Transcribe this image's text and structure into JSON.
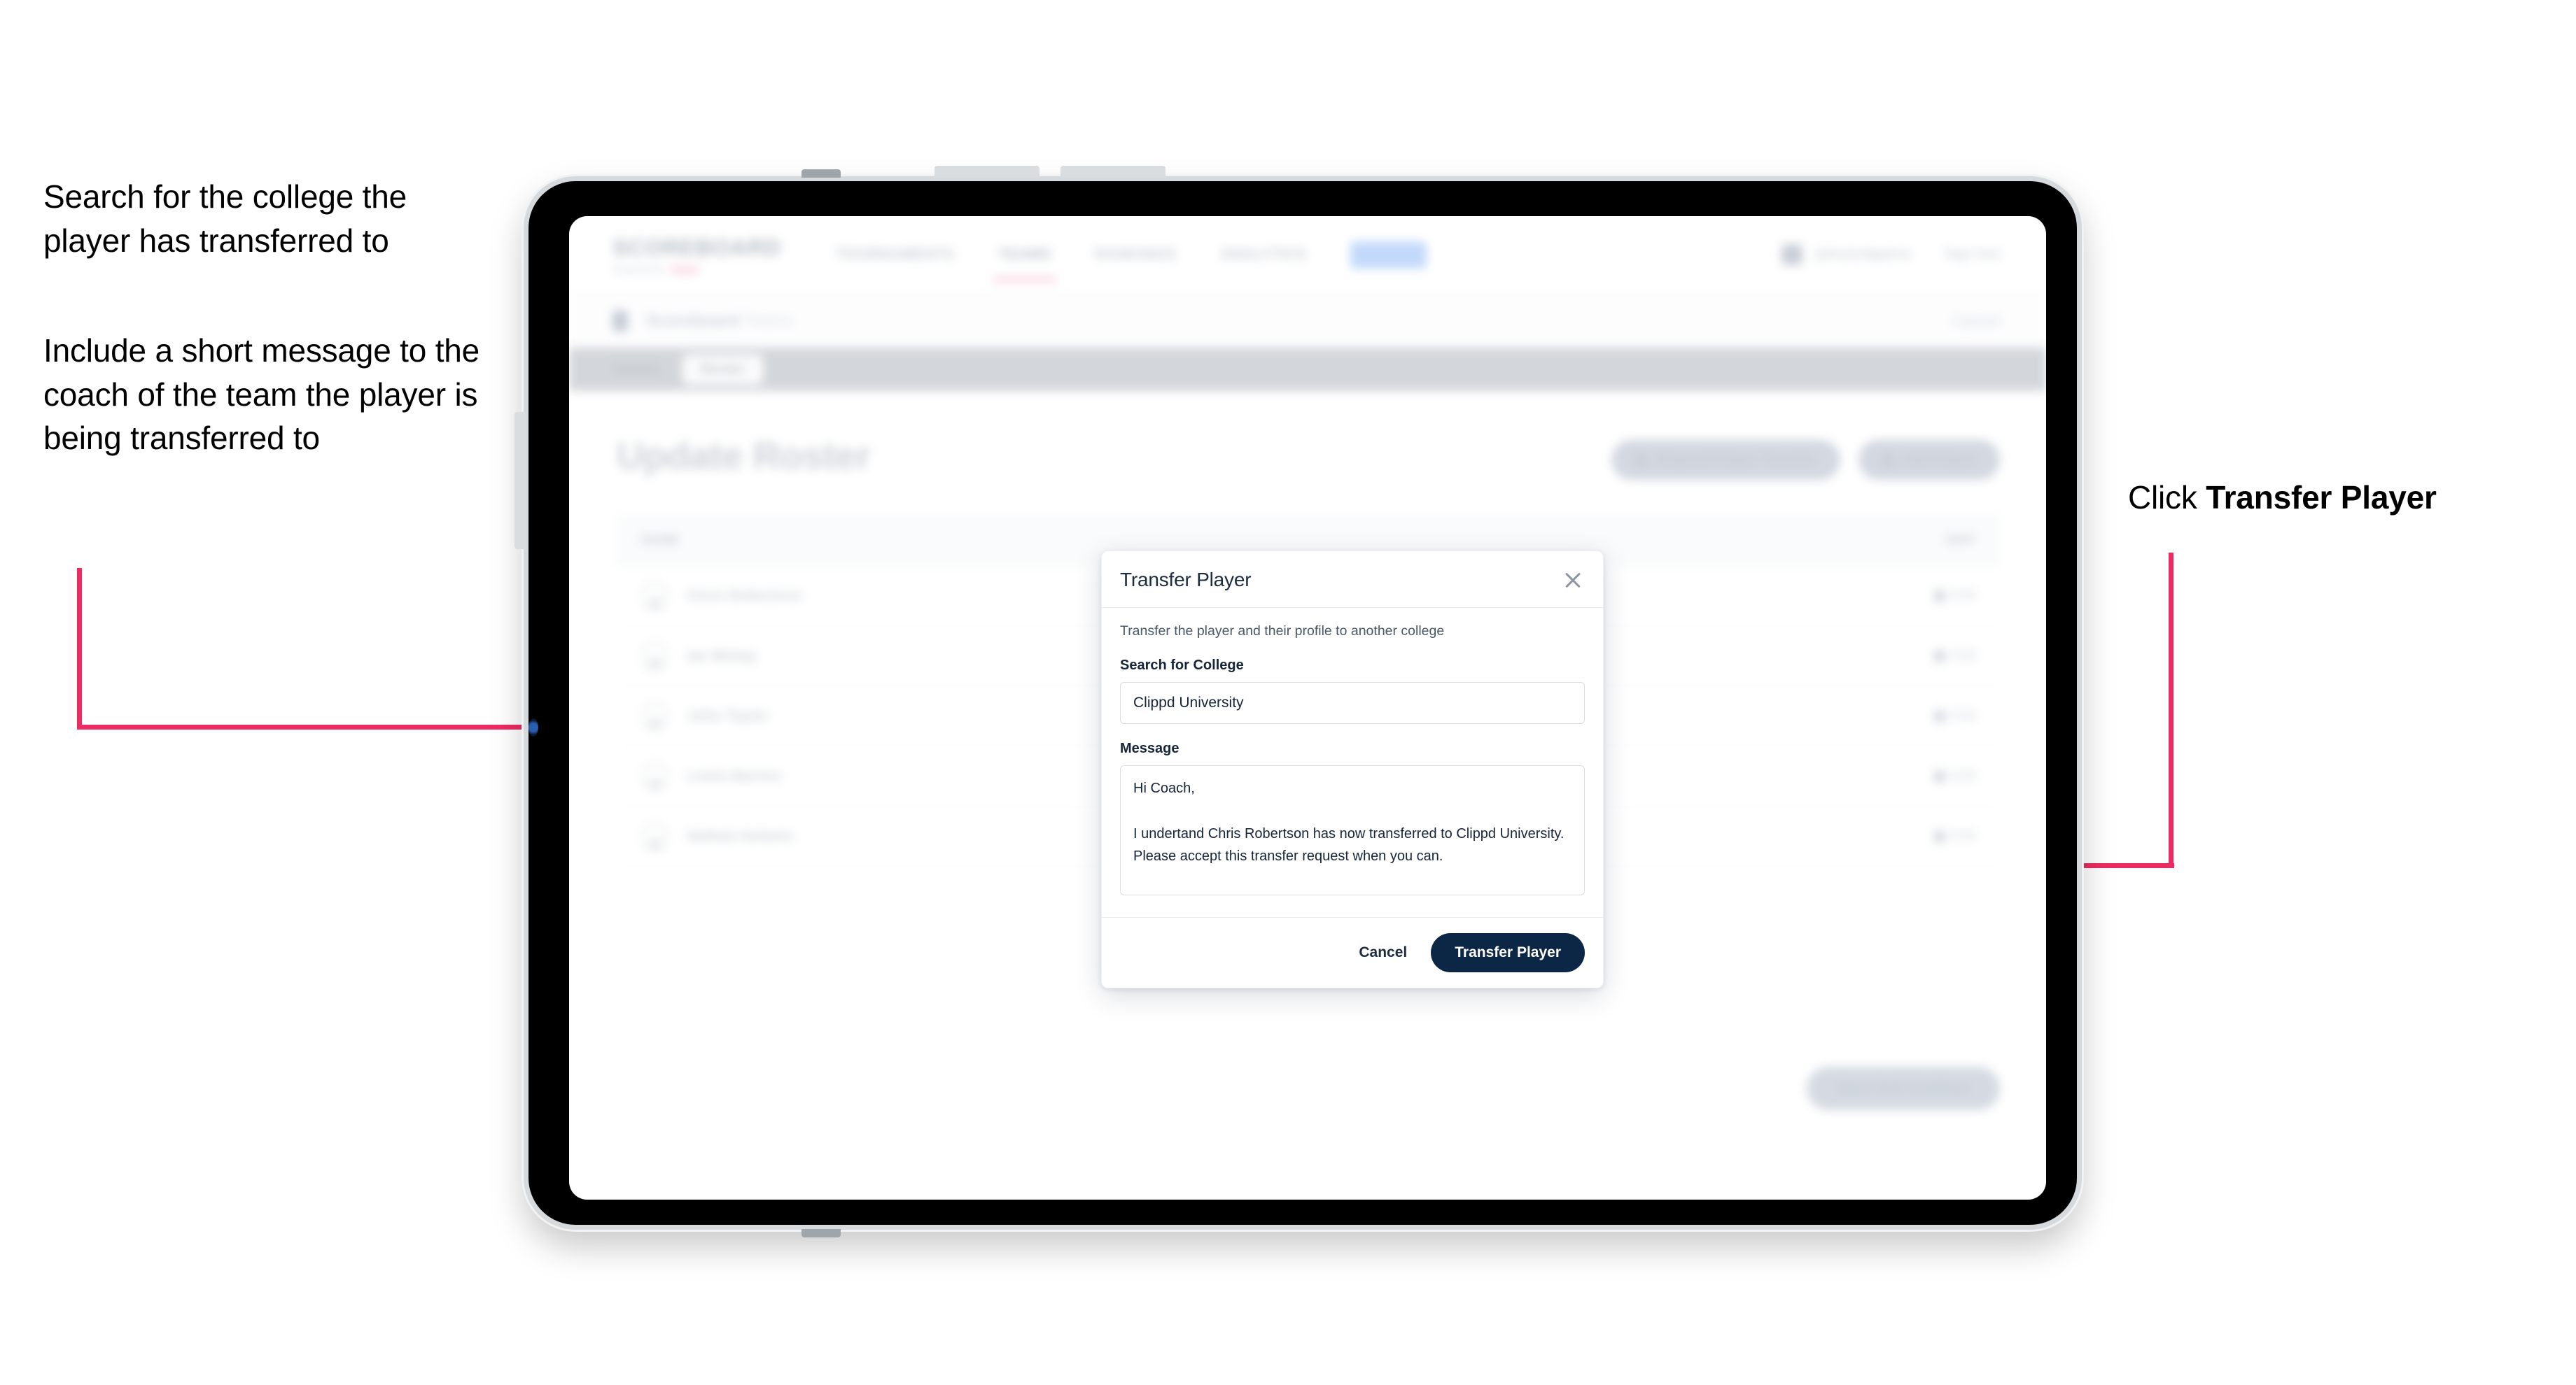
{
  "annotations": {
    "left_1": "Search for the college the player has transferred to",
    "left_2": "Include a short message to the coach of the team the player is being transferred to",
    "right_1_prefix": "Click ",
    "right_1_bold": "Transfer Player"
  },
  "colors": {
    "accent_pink": "#ed2b62",
    "primary_navy": "#0c2745",
    "modal_text": "#16243a"
  },
  "app": {
    "brand": {
      "name": "SCOREBOARD",
      "sub": "Powered by",
      "sub_accent": "clippd"
    },
    "nav": [
      {
        "label": "TOURNAMENTS",
        "active": false
      },
      {
        "label": "TEAMS",
        "active": true
      },
      {
        "label": "RANKINGS",
        "active": false
      },
      {
        "label": "ANALYTICS",
        "active": false
      }
    ],
    "nav_pill": "ADMIN",
    "user": {
      "name": "john@clippd.io",
      "signout": "Sign Out"
    },
    "breadcrumb": {
      "title": "Scoreboard",
      "suffix": "Teams",
      "right": "Cancel"
    },
    "tabs": [
      {
        "label": "Details",
        "active": false
      },
      {
        "label": "Roster",
        "active": true
      }
    ],
    "page_title": "Update Roster",
    "page_actions": [
      {
        "label": "Request Player Transfer"
      },
      {
        "label": "Add Player"
      }
    ],
    "table": {
      "columns": {
        "name": "NAME",
        "edit": "EDIT"
      },
      "rows": [
        {
          "name": "Chris Robertson",
          "edit": "Edit"
        },
        {
          "name": "Ian Mckay",
          "edit": "Edit"
        },
        {
          "name": "John Taylor",
          "edit": "Edit"
        },
        {
          "name": "Lewis Barnes",
          "edit": "Edit"
        },
        {
          "name": "Nathan Holmes",
          "edit": "Edit"
        }
      ]
    },
    "bottom_action": "Save And Continue"
  },
  "modal": {
    "title": "Transfer Player",
    "close_icon": "close-icon",
    "subtitle": "Transfer the player and their profile to another college",
    "college_label": "Search for College",
    "college_value": "Clippd University",
    "college_placeholder": "Search for College",
    "message_label": "Message",
    "message_value": "Hi Coach,\n\nI undertand Chris Robertson has now transferred to Clippd University. Please accept this transfer request when you can.",
    "message_placeholder": "Message",
    "cancel_label": "Cancel",
    "submit_label": "Transfer Player"
  }
}
